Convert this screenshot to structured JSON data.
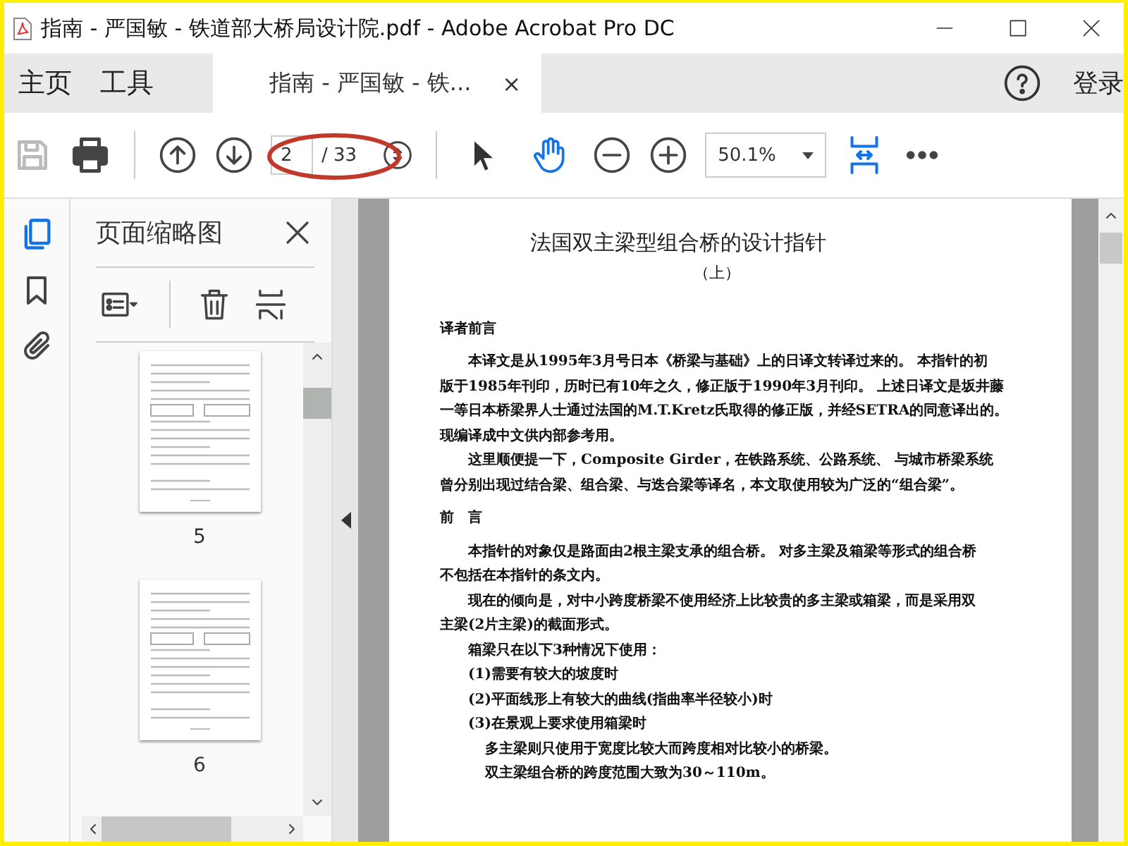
{
  "window": {
    "title": "指南 - 严国敏 - 铁道部大桥局设计院.pdf - Adobe Acrobat Pro DC"
  },
  "nav": [
    {
      "label": "主页",
      "selected": false
    },
    {
      "label": "工具",
      "selected": false
    }
  ],
  "doc_tab": {
    "label": "指南 - 严国敏 - 铁...",
    "selected": true,
    "close": "×"
  },
  "sign_in": "登录",
  "toolbar": {
    "save": {
      "disabled": true
    },
    "page_value": "2",
    "page_total": "/ 33",
    "select_tool": {
      "selected": false
    },
    "hand_tool": {
      "selected": true
    },
    "zoom_value": "50.1%"
  },
  "side_rail": [
    {
      "kind": "pages",
      "selected": true
    },
    {
      "kind": "bookmarks",
      "selected": false
    },
    {
      "kind": "attachments",
      "selected": false
    }
  ],
  "thumbnail_panel": {
    "title": "页面缩略图",
    "pages": [
      {
        "label": "5"
      },
      {
        "label": "6"
      }
    ]
  },
  "document": {
    "lines": [
      {
        "kind": "title",
        "text": "法国双主梁型组合桥的设计指针"
      },
      {
        "kind": "subtitle",
        "text": "（上）"
      },
      {
        "kind": "heading",
        "text": "译者前言"
      },
      {
        "kind": "indent",
        "text": "本译文是从1995年3月号日本《桥梁与基础》上的日译文转译过来的。 本指针的初"
      },
      {
        "kind": "line",
        "text": "版于1985年刊印，历时已有10年之久，修正版于1990年3月刊印。 上述日译文是坂井藤"
      },
      {
        "kind": "line",
        "text": "一等日本桥梁界人士通过法国的M.T.Kretz氏取得的修正版，并经SETRA的同意译出的。"
      },
      {
        "kind": "line",
        "text": "现编译成中文供内部参考用。"
      },
      {
        "kind": "indent",
        "text": "这里顺便提一下，Composite Girder，在铁路系统、公路系统、 与城市桥梁系统"
      },
      {
        "kind": "line",
        "text": "曾分别出现过结合梁、组合梁、与迭合梁等译名，本文取使用较为广泛的“组合梁”。"
      },
      {
        "kind": "heading",
        "text": "前　言"
      },
      {
        "kind": "indent",
        "text": "本指针的对象仅是路面由2根主梁支承的组合桥。 对多主梁及箱梁等形式的组合桥"
      },
      {
        "kind": "line",
        "text": "不包括在本指针的条文内。"
      },
      {
        "kind": "indent",
        "text": "现在的倾向是，对中小跨度桥梁不使用经济上比较贵的多主梁或箱梁，而是采用双"
      },
      {
        "kind": "line",
        "text": "主梁(2片主梁)的截面形式。"
      },
      {
        "kind": "indent",
        "text": "箱梁只在以下3种情况下使用："
      },
      {
        "kind": "indent",
        "text": "(1)需要有较大的坡度时"
      },
      {
        "kind": "indent",
        "text": "(2)平面线形上有较大的曲线(指曲率半径较小)时"
      },
      {
        "kind": "indent",
        "text": "(3)在景观上要求使用箱梁时"
      },
      {
        "kind": "indent2",
        "text": "多主梁则只使用于宽度比较大而跨度相对比较小的桥梁。"
      },
      {
        "kind": "indent2",
        "text": "双主梁组合桥的跨度范围大致为30～110m。"
      }
    ]
  }
}
